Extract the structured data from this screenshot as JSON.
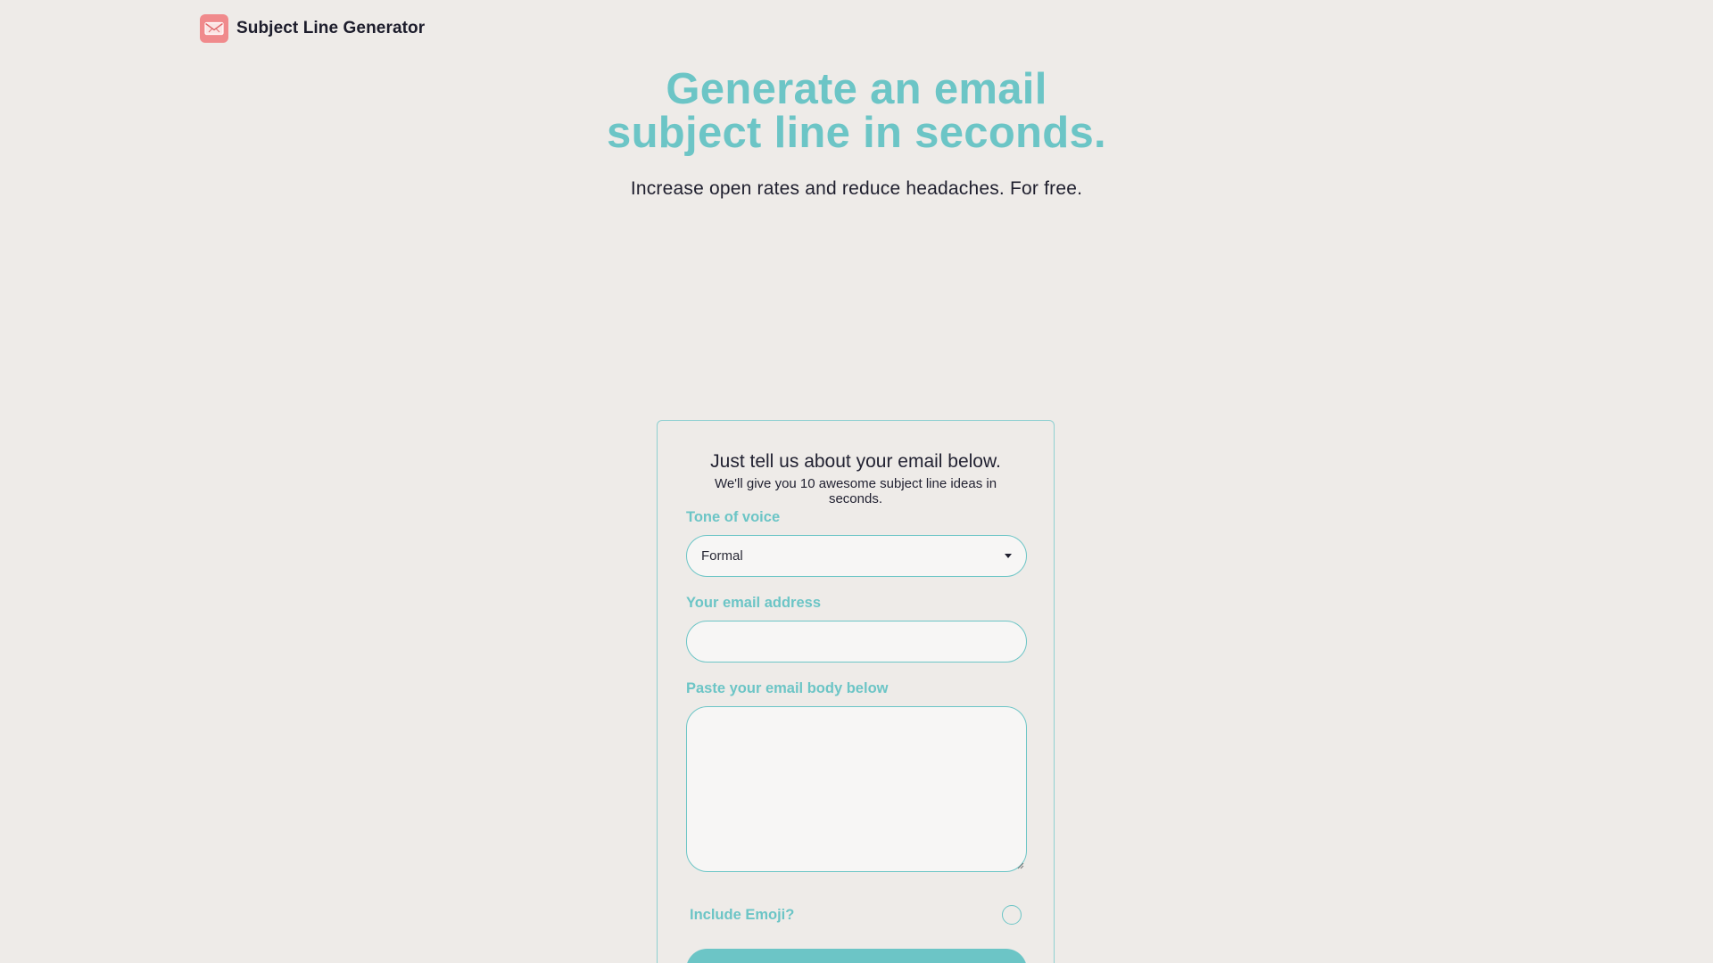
{
  "header": {
    "brand_name": "Subject Line Generator",
    "logo_icon": "envelope-icon",
    "logo_color": "#f08a8c"
  },
  "hero": {
    "title_line1": "Generate an email",
    "title_line2": "subject line in seconds.",
    "subtitle": "Increase open rates and reduce headaches. For free."
  },
  "form": {
    "heading": "Just tell us about your email below.",
    "subheading": "We'll give you 10 awesome subject line ideas in seconds.",
    "tone": {
      "label": "Tone of voice",
      "selected": "Formal"
    },
    "email": {
      "label": "Your email address",
      "value": "",
      "placeholder": ""
    },
    "body": {
      "label": "Paste your email body below",
      "value": "",
      "placeholder": ""
    },
    "emoji": {
      "label": "Include Emoji?",
      "checked": false
    },
    "submit_label": ""
  },
  "colors": {
    "accent": "#6cc5c6",
    "background": "#eeebe8",
    "field_background": "#f7f6f5",
    "text": "#1f1f2e"
  }
}
